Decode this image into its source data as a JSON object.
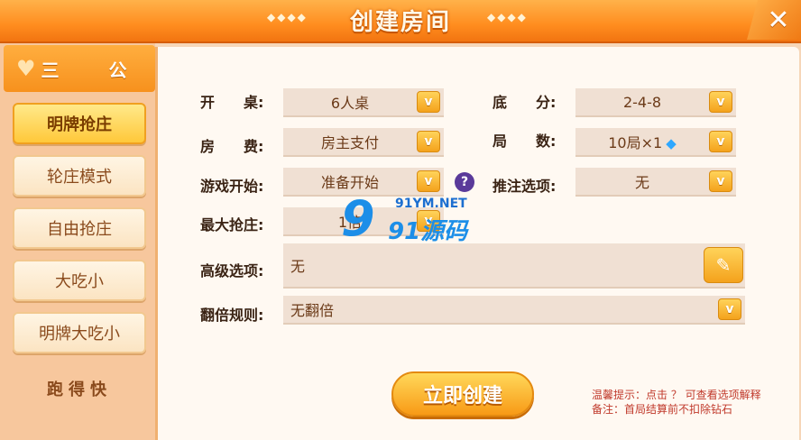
{
  "header": {
    "title": "创建房间",
    "deco_left": "◆◆◆◆",
    "deco_right": "◆◆◆◆",
    "close_icon": "crossed-tools-icon"
  },
  "sidebar": {
    "active_tab": "三  公",
    "modes": [
      "明牌抢庄",
      "轮庄模式",
      "自由抢庄",
      "大吃小",
      "明牌大吃小"
    ],
    "selected_index": 0,
    "bottom_tab": "跑得快"
  },
  "form": {
    "table": {
      "label": "开　　桌:",
      "value": "6人桌"
    },
    "base_score": {
      "label": "底　　分:",
      "value": "2-4-8"
    },
    "fee": {
      "label": "房　　费:",
      "value": "房主支付"
    },
    "rounds": {
      "label": "局　　数:",
      "value": "10局×1"
    },
    "start": {
      "label": "游戏开始:",
      "value": "准备开始"
    },
    "push_bet": {
      "label": "推注选项:",
      "value": "无"
    },
    "max_grab": {
      "label": "最大抢庄:",
      "value": "1倍"
    },
    "advanced": {
      "label": "高级选项:",
      "value": "无"
    },
    "double_rule": {
      "label": "翻倍规则:",
      "value": "无翻倍"
    }
  },
  "watermark": {
    "big": "9",
    "net": "91YM.NET",
    "cn": "91源码"
  },
  "create_button": "立即创建",
  "notes": [
    "温馨提示：点击 ？ 可查看选项解释",
    "备注：首局结算前不扣除钻石"
  ],
  "colors": {
    "accent": "#f7911d",
    "label": "#3a2314",
    "note": "#c0392b"
  }
}
